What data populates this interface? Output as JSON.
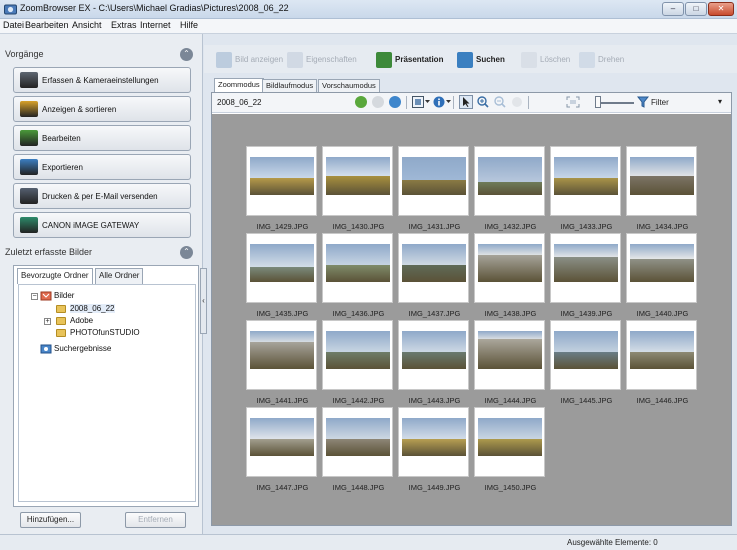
{
  "window": {
    "title": "ZoomBrowser EX - C:\\Users\\Michael Gradias\\Pictures\\2008_06_22",
    "min_glyph": "–",
    "max_glyph": "□",
    "close_glyph": "✕"
  },
  "menu": [
    "Datei",
    "Bearbeiten",
    "Ansicht",
    "Extras",
    "Internet",
    "Hilfe"
  ],
  "left_panel": {
    "tasks_header": "Vorgänge",
    "tasks": [
      {
        "label": "Erfassen & Kameraeinstellungen",
        "icon": "camera-icon",
        "color": "#5d6672"
      },
      {
        "label": "Anzeigen & sortieren",
        "icon": "view-sort-icon",
        "color": "#d8a22a"
      },
      {
        "label": "Bearbeiten",
        "icon": "edit-icon",
        "color": "#4a9a3a"
      },
      {
        "label": "Exportieren",
        "icon": "export-icon",
        "color": "#3c7fc2"
      },
      {
        "label": "Drucken & per E-Mail versenden",
        "icon": "print-icon",
        "color": "#556070"
      },
      {
        "label": "CANON iMAGE GATEWAY",
        "icon": "gateway-icon",
        "color": "#2d8a6a"
      }
    ],
    "recent_header": "Zuletzt erfasste Bilder",
    "tree_tabs": [
      "Bevorzugte Ordner",
      "Alle Ordner"
    ],
    "tree": {
      "root": "Bilder",
      "children": [
        "2008_06_22",
        "Adobe",
        "PHOTOfunSTUDIO"
      ],
      "search_results": "Suchergebnisse"
    },
    "add_button": "Hinzufügen...",
    "remove_button": "Entfernen",
    "collapse_glyph": "⌃",
    "splitter_glyph": "‹"
  },
  "toolbar": {
    "items": [
      {
        "label": "Bild anzeigen",
        "enabled": false,
        "icon": "view-image-icon"
      },
      {
        "label": "Eigenschaften",
        "enabled": false,
        "icon": "properties-icon"
      },
      {
        "label": "Präsentation",
        "enabled": true,
        "icon": "presentation-icon"
      },
      {
        "label": "Suchen",
        "enabled": true,
        "icon": "search-icon"
      },
      {
        "label": "Löschen",
        "enabled": false,
        "icon": "delete-icon"
      },
      {
        "label": "Drehen",
        "enabled": false,
        "icon": "rotate-icon"
      }
    ]
  },
  "modes": [
    "Zoommodus",
    "Bildlaufmodus",
    "Vorschaumodus"
  ],
  "path": "2008_06_22",
  "filter": "Filter",
  "filter_arrow": "▾",
  "thumbnails": [
    "IMG_1429.JPG",
    "IMG_1430.JPG",
    "IMG_1431.JPG",
    "IMG_1432.JPG",
    "IMG_1433.JPG",
    "IMG_1434.JPG",
    "IMG_1435.JPG",
    "IMG_1436.JPG",
    "IMG_1437.JPG",
    "IMG_1438.JPG",
    "IMG_1439.JPG",
    "IMG_1440.JPG",
    "IMG_1441.JPG",
    "IMG_1442.JPG",
    "IMG_1443.JPG",
    "IMG_1444.JPG",
    "IMG_1445.JPG",
    "IMG_1446.JPG",
    "IMG_1447.JPG",
    "IMG_1448.JPG",
    "IMG_1449.JPG",
    "IMG_1450.JPG"
  ],
  "status": "Ausgewählte Elemente: 0"
}
